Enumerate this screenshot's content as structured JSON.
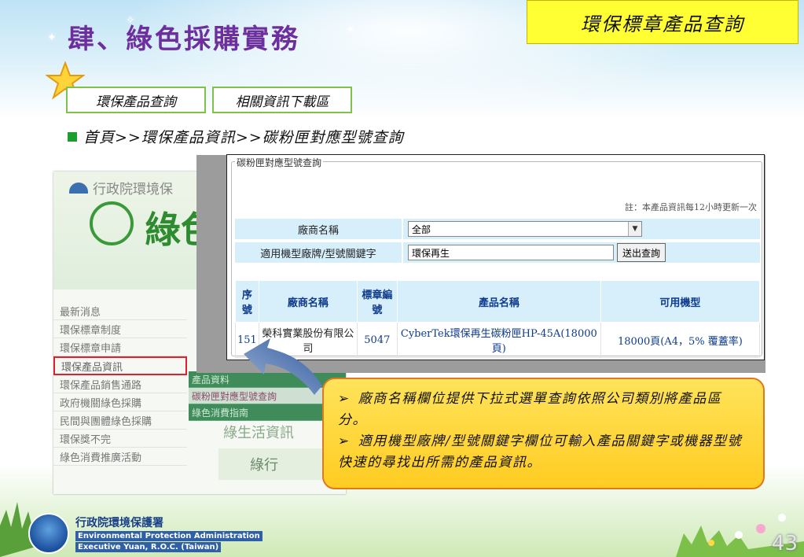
{
  "slide": {
    "title": "肆、綠色採購實務",
    "header_box": "環保標章產品查詢",
    "tabs": [
      {
        "label": "環保產品查詢"
      },
      {
        "label": "相關資訊下載區"
      }
    ],
    "breadcrumb": "首頁>>環保產品資訊>>碳粉匣對應型號查詢",
    "page_number": "43"
  },
  "site": {
    "agency": "行政院環境保",
    "brand": "綠色",
    "menu": [
      "最新消息",
      "環保標章制度",
      "環保標章申請",
      "環保產品資訊",
      "環保產品銷售通路",
      "政府機關綠色採購",
      "民間與團體綠色採購",
      "環保獎不完",
      "綠色消費推廣活動"
    ],
    "submenu": [
      "產品資料",
      "碳粉匣對應型號查詢",
      "綠色消費指南"
    ],
    "mid_text": "綠生活資訊",
    "banner": "綠行"
  },
  "form": {
    "legend": "碳粉匣對應型號查詢",
    "note": "註：本產品資訊每12小時更新一次",
    "vendor_label": "廠商名稱",
    "vendor_selected": "全部",
    "keyword_label": "適用機型廠牌/型號關鍵字",
    "keyword_value": "環保再生",
    "submit_label": "送出查詢"
  },
  "table": {
    "headers": [
      "序號",
      "廠商名稱",
      "標章編號",
      "產品名稱",
      "可用機型"
    ],
    "rows": [
      {
        "no": "151",
        "vendor": "榮科實業股份有限公司",
        "label_no": "5047",
        "product": "CyberTek環保再生碳粉匣HP-45A(18000頁)",
        "models": "18000頁(A4，5% 覆蓋率)"
      }
    ]
  },
  "callout": {
    "lines": [
      "廠商名稱欄位提供下拉式選單查詢依照公司類別將產品區分。",
      "適用機型廠牌/型號關鍵字欄位可輸入產品關鍵字或機器型號快速的尋找出所需的產品資訊。"
    ],
    "marker": "➢"
  },
  "footer": {
    "org_zh": "行政院環境保護署",
    "org_en_1": "Environmental Protection Administration",
    "org_en_2": "Executive Yuan, R.O.C. (Taiwan)"
  },
  "colors": {
    "title": "#6d2f9e",
    "header_box": "#ffff33",
    "tab_border": "#7fc24a",
    "form_row_bg": "#d7eefb",
    "table_text": "#0e3b8c",
    "callout_bg": "#ffcc22",
    "callout_border": "#e0791e",
    "menu_highlight": "#e0202c"
  },
  "icons": {
    "star": "star-icon",
    "bullet": "square-bullet-icon",
    "select_arrow": "chevron-down-icon",
    "callout_arrow": "curved-arrow-icon",
    "footer_logo": "epa-logo-icon"
  }
}
